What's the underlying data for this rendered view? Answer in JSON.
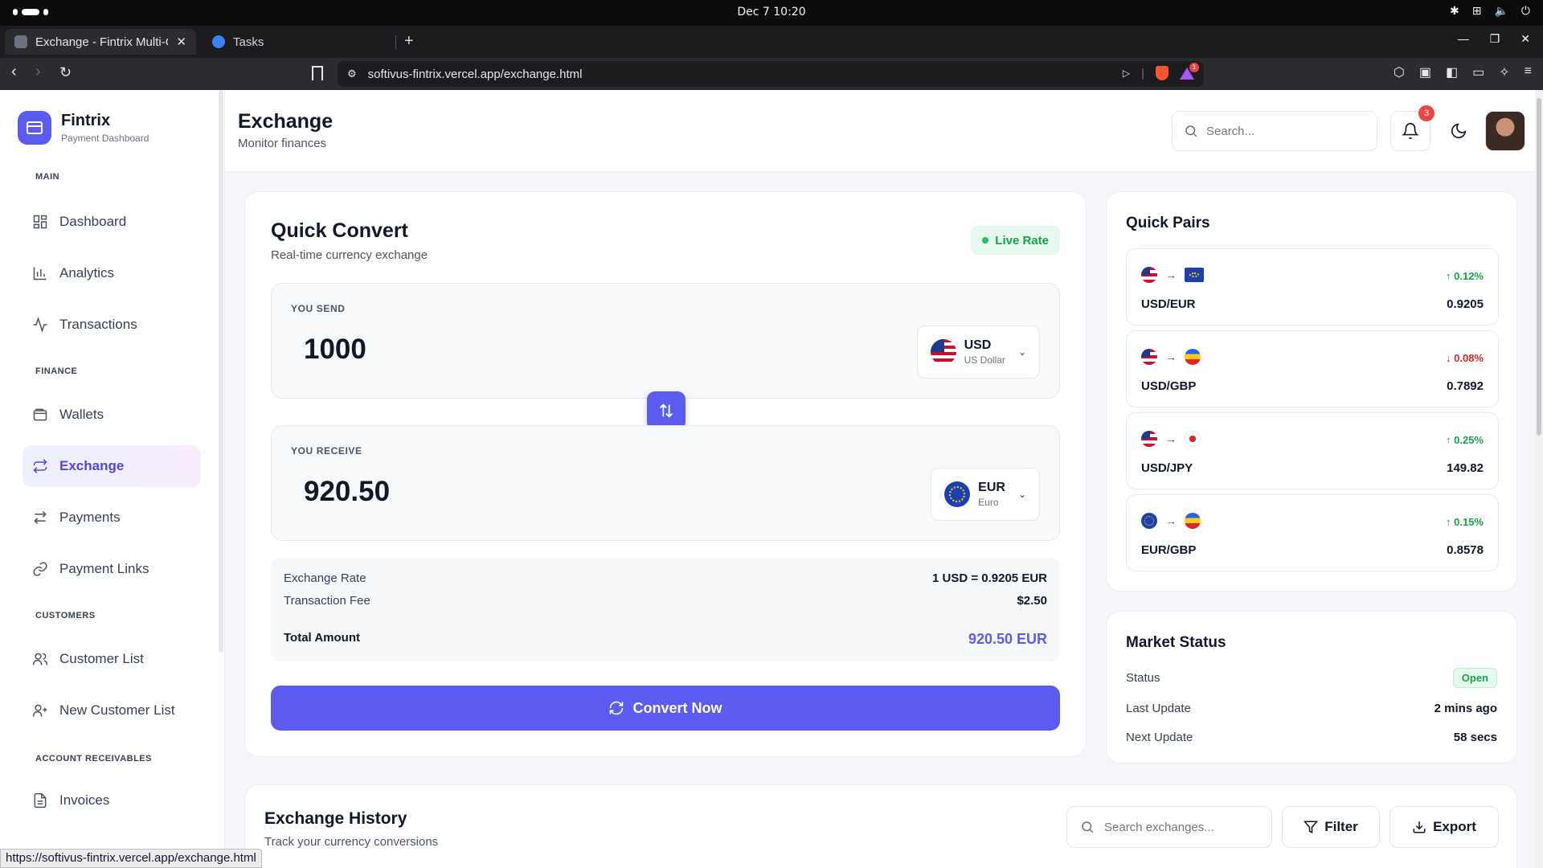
{
  "os": {
    "datetime": "Dec 7  10:20"
  },
  "browser": {
    "tabs": [
      {
        "title": "Exchange - Fintrix Multi-C",
        "active": true
      },
      {
        "title": "Tasks",
        "active": false
      }
    ],
    "url": "softivus-fintrix.vercel.app/exchange.html",
    "rewards_count": "1",
    "status_url": "https://softivus-fintrix.vercel.app/exchange.html"
  },
  "brand": {
    "name": "Fintrix",
    "subtitle": "Payment Dashboard",
    "color": "#5b5bf0"
  },
  "sidebar": {
    "sections": [
      {
        "title": "MAIN",
        "items": [
          {
            "label": "Dashboard",
            "icon": "grid-icon"
          },
          {
            "label": "Analytics",
            "icon": "bar-chart-icon"
          },
          {
            "label": "Transactions",
            "icon": "activity-icon"
          }
        ]
      },
      {
        "title": "FINANCE",
        "items": [
          {
            "label": "Wallets",
            "icon": "wallet-icon"
          },
          {
            "label": "Exchange",
            "icon": "refresh-icon",
            "active": true
          },
          {
            "label": "Payments",
            "icon": "arrows-icon"
          },
          {
            "label": "Payment Links",
            "icon": "link-icon"
          }
        ]
      },
      {
        "title": "CUSTOMERS",
        "items": [
          {
            "label": "Customer List",
            "icon": "users-icon"
          },
          {
            "label": "New Customer List",
            "icon": "user-plus-icon"
          }
        ]
      },
      {
        "title": "ACCOUNT RECEIVABLES",
        "items": [
          {
            "label": "Invoices",
            "icon": "file-icon"
          }
        ]
      }
    ]
  },
  "header": {
    "title": "Exchange",
    "subtitle": "Monitor finances",
    "search_placeholder": "Search...",
    "notifications_count": "3"
  },
  "quick_convert": {
    "title": "Quick Convert",
    "subtitle": "Real-time currency exchange",
    "live_label": "Live Rate",
    "send": {
      "label": "YOU SEND",
      "amount": "1000",
      "currency_code": "USD",
      "currency_name": "US Dollar"
    },
    "receive": {
      "label": "YOU RECEIVE",
      "amount": "920.50",
      "currency_code": "EUR",
      "currency_name": "Euro"
    },
    "summary": {
      "rate_label": "Exchange Rate",
      "rate_value": "1 USD = 0.9205 EUR",
      "fee_label": "Transaction Fee",
      "fee_value": "$2.50",
      "total_label": "Total Amount",
      "total_value": "920.50 EUR"
    },
    "convert_label": "Convert Now"
  },
  "quick_pairs": {
    "title": "Quick Pairs",
    "pairs": [
      {
        "name": "USD/EUR",
        "rate": "0.9205",
        "change": "0.12%",
        "direction": "up",
        "from": "us",
        "to": "eu"
      },
      {
        "name": "USD/GBP",
        "rate": "0.7892",
        "change": "0.08%",
        "direction": "down",
        "from": "us",
        "to": "gb"
      },
      {
        "name": "USD/JPY",
        "rate": "149.82",
        "change": "0.25%",
        "direction": "up",
        "from": "us",
        "to": "jp"
      },
      {
        "name": "EUR/GBP",
        "rate": "0.8578",
        "change": "0.15%",
        "direction": "up",
        "from": "eu",
        "to": "gb"
      }
    ]
  },
  "market_status": {
    "title": "Market Status",
    "status_label": "Status",
    "status_value": "Open",
    "last_update_label": "Last Update",
    "last_update_value": "2 mins ago",
    "next_update_label": "Next Update",
    "next_update_value": "58 secs"
  },
  "history": {
    "title": "Exchange History",
    "subtitle": "Track your currency conversions",
    "search_placeholder": "Search exchanges...",
    "filter_label": "Filter",
    "export_label": "Export"
  }
}
